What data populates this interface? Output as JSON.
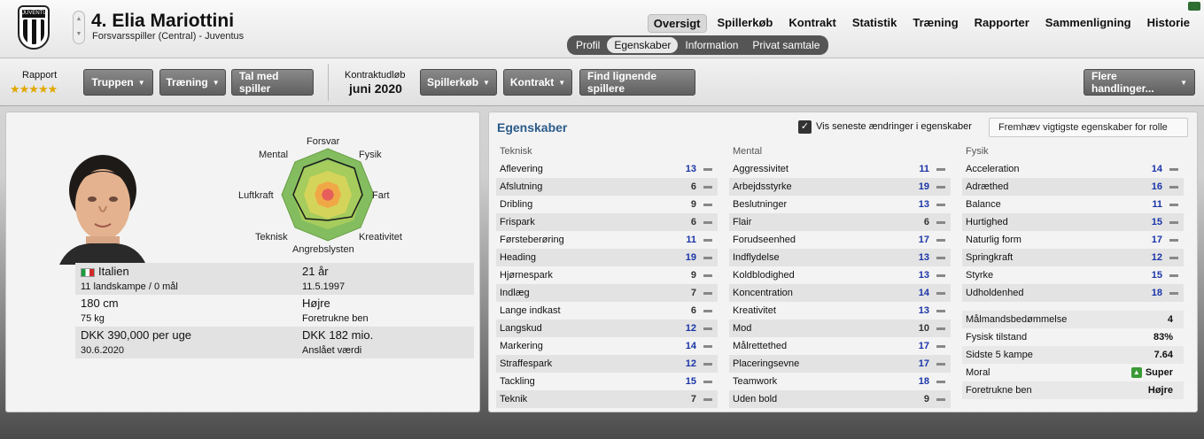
{
  "header": {
    "player_title": "4. Elia Mariottini",
    "player_subtitle": "Forsvarsspiller (Central) - Juventus",
    "crest_text": "JUVENTUS",
    "nav_tabs": [
      "Oversigt",
      "Spillerkøb",
      "Kontrakt",
      "Statistik",
      "Træning",
      "Rapporter",
      "Sammenligning",
      "Historie"
    ],
    "active_nav": "Oversigt",
    "sub_tabs": [
      "Profil",
      "Egenskaber",
      "Information",
      "Privat samtale"
    ],
    "active_sub": "Egenskaber"
  },
  "toolbar": {
    "rapport_label": "Rapport",
    "stars": "★★★★★",
    "rating_stars": 4.5,
    "truppen": "Truppen",
    "traening": "Træning",
    "tal_med": "Tal med spiller",
    "kontrakt_label": "Kontraktudløb",
    "kontrakt_value": "juni 2020",
    "spillerkob": "Spillerkøb",
    "kontrakt": "Kontrakt",
    "find": "Find lignende spillere",
    "flere": "Flere handlinger..."
  },
  "radar": {
    "labels": {
      "forsvar": "Forsvar",
      "fysik": "Fysik",
      "fart": "Fart",
      "kreativitet": "Kreativitet",
      "angrebslysten": "Angrebslysten",
      "teknisk": "Teknisk",
      "luftkraft": "Luftkraft",
      "mental": "Mental"
    },
    "colors": {
      "outer": "#7fbf5a",
      "mid": "#c8d85a",
      "inner": "#f0b040",
      "core": "#e8665a"
    }
  },
  "info": {
    "nationality": "Italien",
    "caps": "11 landskampe / 0 mål",
    "age": "21 år",
    "dob": "11.5.1997",
    "height": "180 cm",
    "weight": "75 kg",
    "foot": "Højre",
    "foot_label": "Foretrukne ben",
    "wage": "DKK 390,000 per uge",
    "contract_end": "30.6.2020",
    "value": "DKK 182 mio.",
    "value_label": "Anslået værdi"
  },
  "attributes_panel": {
    "title": "Egenskaber",
    "checkbox_label": "Vis seneste ændringer i egenskaber",
    "highlight_dropdown": "Fremhæv vigtigste egenskaber for rolle",
    "columns": [
      {
        "title": "Teknisk",
        "items": [
          {
            "name": "Aflevering",
            "value": "13",
            "blue": true
          },
          {
            "name": "Afslutning",
            "value": "6",
            "blue": false
          },
          {
            "name": "Dribling",
            "value": "9",
            "blue": false
          },
          {
            "name": "Frispark",
            "value": "6",
            "blue": false
          },
          {
            "name": "Førsteberøring",
            "value": "11",
            "blue": true
          },
          {
            "name": "Heading",
            "value": "19",
            "blue": true
          },
          {
            "name": "Hjørnespark",
            "value": "9",
            "blue": false
          },
          {
            "name": "Indlæg",
            "value": "7",
            "blue": false
          },
          {
            "name": "Lange indkast",
            "value": "6",
            "blue": false
          },
          {
            "name": "Langskud",
            "value": "12",
            "blue": true
          },
          {
            "name": "Markering",
            "value": "14",
            "blue": true
          },
          {
            "name": "Straffespark",
            "value": "12",
            "blue": true
          },
          {
            "name": "Tackling",
            "value": "15",
            "blue": true
          },
          {
            "name": "Teknik",
            "value": "7",
            "blue": false
          }
        ]
      },
      {
        "title": "Mental",
        "items": [
          {
            "name": "Aggressivitet",
            "value": "11",
            "blue": true
          },
          {
            "name": "Arbejdsstyrke",
            "value": "19",
            "blue": true
          },
          {
            "name": "Beslutninger",
            "value": "13",
            "blue": true
          },
          {
            "name": "Flair",
            "value": "6",
            "blue": false
          },
          {
            "name": "Forudseenhed",
            "value": "17",
            "blue": true
          },
          {
            "name": "Indflydelse",
            "value": "13",
            "blue": true
          },
          {
            "name": "Koldblodighed",
            "value": "13",
            "blue": true
          },
          {
            "name": "Koncentration",
            "value": "14",
            "blue": true
          },
          {
            "name": "Kreativitet",
            "value": "13",
            "blue": true
          },
          {
            "name": "Mod",
            "value": "10",
            "blue": false
          },
          {
            "name": "Målrettethed",
            "value": "17",
            "blue": true
          },
          {
            "name": "Placeringsevne",
            "value": "17",
            "blue": true
          },
          {
            "name": "Teamwork",
            "value": "18",
            "blue": true
          },
          {
            "name": "Uden bold",
            "value": "9",
            "blue": false
          }
        ]
      },
      {
        "title": "Fysik",
        "items": [
          {
            "name": "Acceleration",
            "value": "14",
            "blue": true
          },
          {
            "name": "Adræthed",
            "value": "16",
            "blue": true
          },
          {
            "name": "Balance",
            "value": "11",
            "blue": true
          },
          {
            "name": "Hurtighed",
            "value": "15",
            "blue": true
          },
          {
            "name": "Naturlig form",
            "value": "17",
            "blue": true
          },
          {
            "name": "Springkraft",
            "value": "12",
            "blue": true
          },
          {
            "name": "Styrke",
            "value": "15",
            "blue": true
          },
          {
            "name": "Udholdenhed",
            "value": "18",
            "blue": true
          }
        ]
      }
    ],
    "extras": [
      {
        "name": "Målmandsbedømmelse",
        "value": "4"
      },
      {
        "name": "Fysisk tilstand",
        "value": "83%"
      },
      {
        "name": "Sidste 5 kampe",
        "value": "7.64"
      },
      {
        "name": "Moral",
        "value": "Super"
      },
      {
        "name": "Foretrukne ben",
        "value": "Højre"
      }
    ]
  }
}
